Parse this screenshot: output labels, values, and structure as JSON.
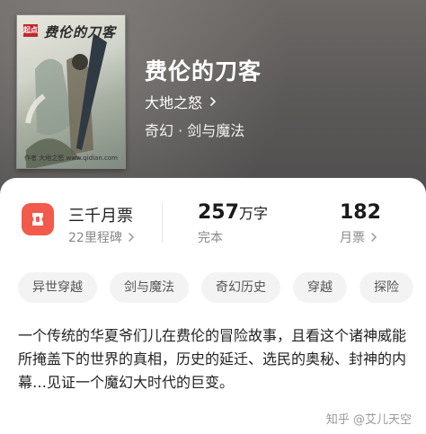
{
  "book": {
    "title": "费伦的刀客",
    "author": "大地之怒",
    "genre": "奇幻 · 剑与魔法",
    "cover_title": "费伦的刀客",
    "cover_seal": "起点",
    "cover_url": "作者 大地之怒 www.qidian.com"
  },
  "stats": {
    "monthly_votes_label": "三千月票",
    "milestone_label": "22里程碑",
    "word_count": "257",
    "word_unit": "万字",
    "status": "完本",
    "monthly_votes_count": "182",
    "monthly_votes_sub": "月票"
  },
  "tags": [
    "异世穿越",
    "剑与魔法",
    "奇幻历史",
    "穿越",
    "探险"
  ],
  "description": "一个传统的华夏爷们儿在费伦的冒险故事，且看这个诸神威能所掩盖下的世界的真相，历史的延迁、选民的奥秘、封神的内幕…见证一个魔幻大时代的巨变。",
  "watermark": "知乎 @艾儿天空",
  "colors": {
    "accent": "#f25a4b",
    "hero_bg": "#5c5a59",
    "tag_bg": "#f3f3f3"
  }
}
